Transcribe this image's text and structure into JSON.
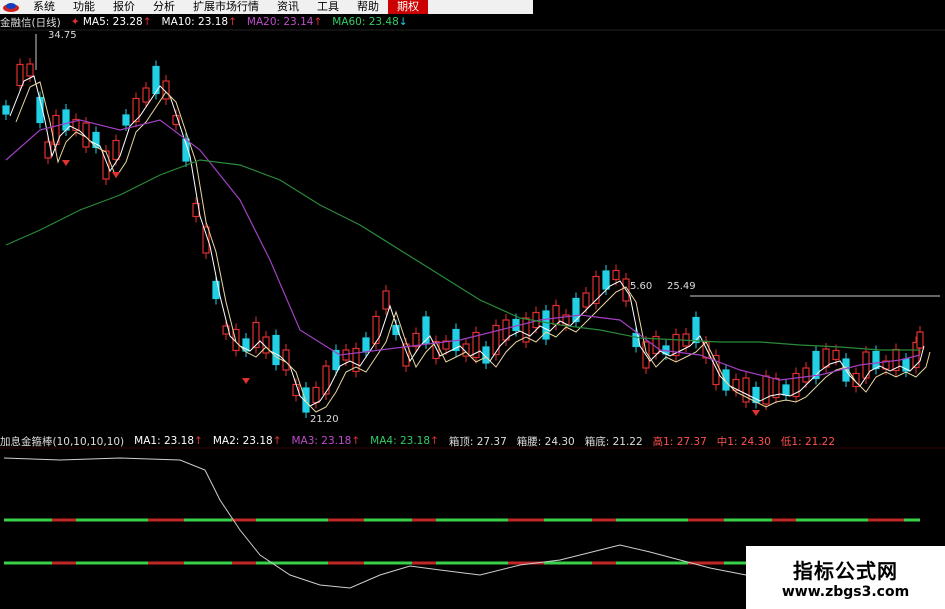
{
  "menu": {
    "items": [
      {
        "label": "系统",
        "active": false
      },
      {
        "label": "功能",
        "active": false
      },
      {
        "label": "报价",
        "active": false
      },
      {
        "label": "分析",
        "active": false
      },
      {
        "label": "扩展市场行情",
        "active": false
      },
      {
        "label": "资讯",
        "active": false
      },
      {
        "label": "工具",
        "active": false
      },
      {
        "label": "帮助",
        "active": false
      },
      {
        "label": "期权",
        "active": true
      }
    ]
  },
  "main_chart": {
    "title": "金融信(日线)",
    "ma": [
      {
        "label": "MA5: 23.28",
        "arrow": "↑",
        "color": "#ffffff"
      },
      {
        "label": "MA10: 23.18",
        "arrow": "↑",
        "color": "#ffffff"
      },
      {
        "label": "MA20: 23.14",
        "arrow": "↑",
        "color": "#c04ccc"
      },
      {
        "label": "MA60: 23.48",
        "arrow": "↓",
        "color": "#33cc66"
      }
    ],
    "high_label": "34.75",
    "low_label": "21.20",
    "mid_label": "5.60",
    "right_label": "25.49"
  },
  "indicator": {
    "title": "加息金箍棒(10,10,10,10)",
    "items": [
      {
        "label": "MA1: 23.18",
        "arrow": "↑",
        "color": "#ffffff"
      },
      {
        "label": "MA2: 23.18",
        "arrow": "↑",
        "color": "#ffffff"
      },
      {
        "label": "MA3: 23.18",
        "arrow": "↑",
        "color": "#c04ccc"
      },
      {
        "label": "MA4: 23.18",
        "arrow": "↑",
        "color": "#33cc66"
      },
      {
        "label": "箱顶: 27.37",
        "arrow": "",
        "color": "#dddddd"
      },
      {
        "label": "箱腰: 24.30",
        "arrow": "",
        "color": "#dddddd"
      },
      {
        "label": "箱底: 21.22",
        "arrow": "",
        "color": "#dddddd"
      },
      {
        "label": "高1: 27.37",
        "arrow": "",
        "color": "#ff5050"
      },
      {
        "label": "中1: 24.30",
        "arrow": "",
        "color": "#ff5050"
      },
      {
        "label": "低1: 21.22",
        "arrow": "",
        "color": "#ff5050"
      }
    ]
  },
  "watermark": {
    "title": "指标公式网",
    "url": "www.zbgs3.com"
  },
  "colors": {
    "up": "#e03030",
    "down": "#22d0e6",
    "ma5": "#ffffff",
    "ma10": "#e8d8a0",
    "ma20": "#a040c0",
    "ma60": "#2a8a3a"
  }
}
